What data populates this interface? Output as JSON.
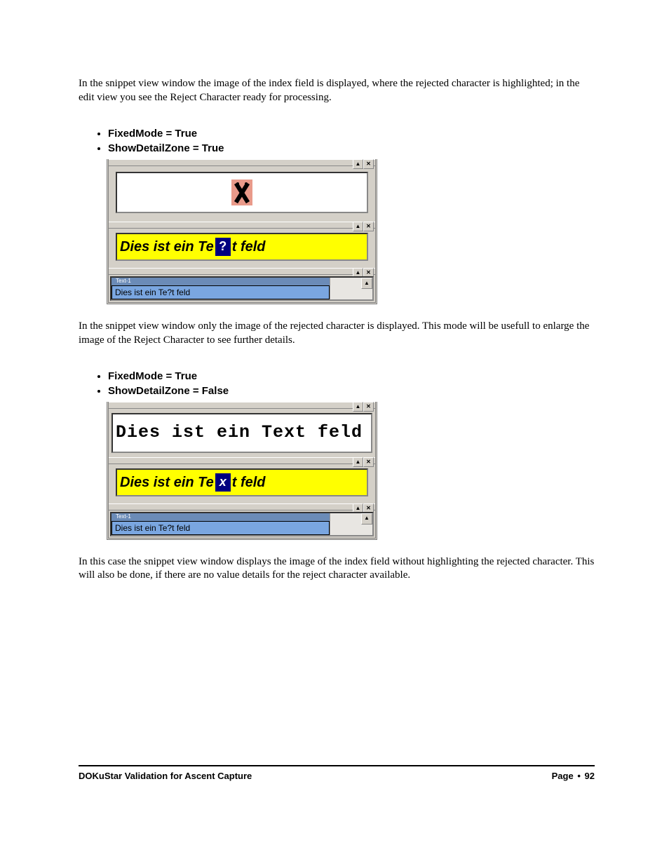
{
  "paragraphs": {
    "p1": "In the snippet view window the image of the index field is displayed, where the rejected character is highlighted; in the edit view you see the Reject Character ready for processing.",
    "p2": "In the snippet view window only the image of the rejected character is displayed. This mode will be usefull to enlarge the image of the Reject Character to see further details.",
    "p3": "In this case the snippet view window displays the image of the index field without highlighting the rejected character. This will also be done, if there are no value details for the reject character available."
  },
  "bullets": {
    "set1": [
      "FixedMode = True",
      "ShowDetailZone = True"
    ],
    "set2": [
      "FixedMode = True",
      "ShowDetailZone = False"
    ]
  },
  "figure1": {
    "ocr_line": {
      "pre": "Dies ist ein Te",
      "reject": "?",
      "post": "t feld"
    },
    "edit_value": "Dies ist ein Te?t feld",
    "grid_label": "Text-1"
  },
  "figure2": {
    "plain_ocr": "Dies ist ein Text feld",
    "ocr_line": {
      "pre": "Dies ist ein Te",
      "reject": "x",
      "post": "t feld"
    },
    "edit_value": "Dies ist ein Te?t feld",
    "grid_label": "Text-1"
  },
  "window_btns": {
    "up": "▲",
    "close": "✕"
  },
  "footer": {
    "left": "DOKuStar Validation for Ascent Capture",
    "page_label": "Page",
    "page_number": "92"
  }
}
